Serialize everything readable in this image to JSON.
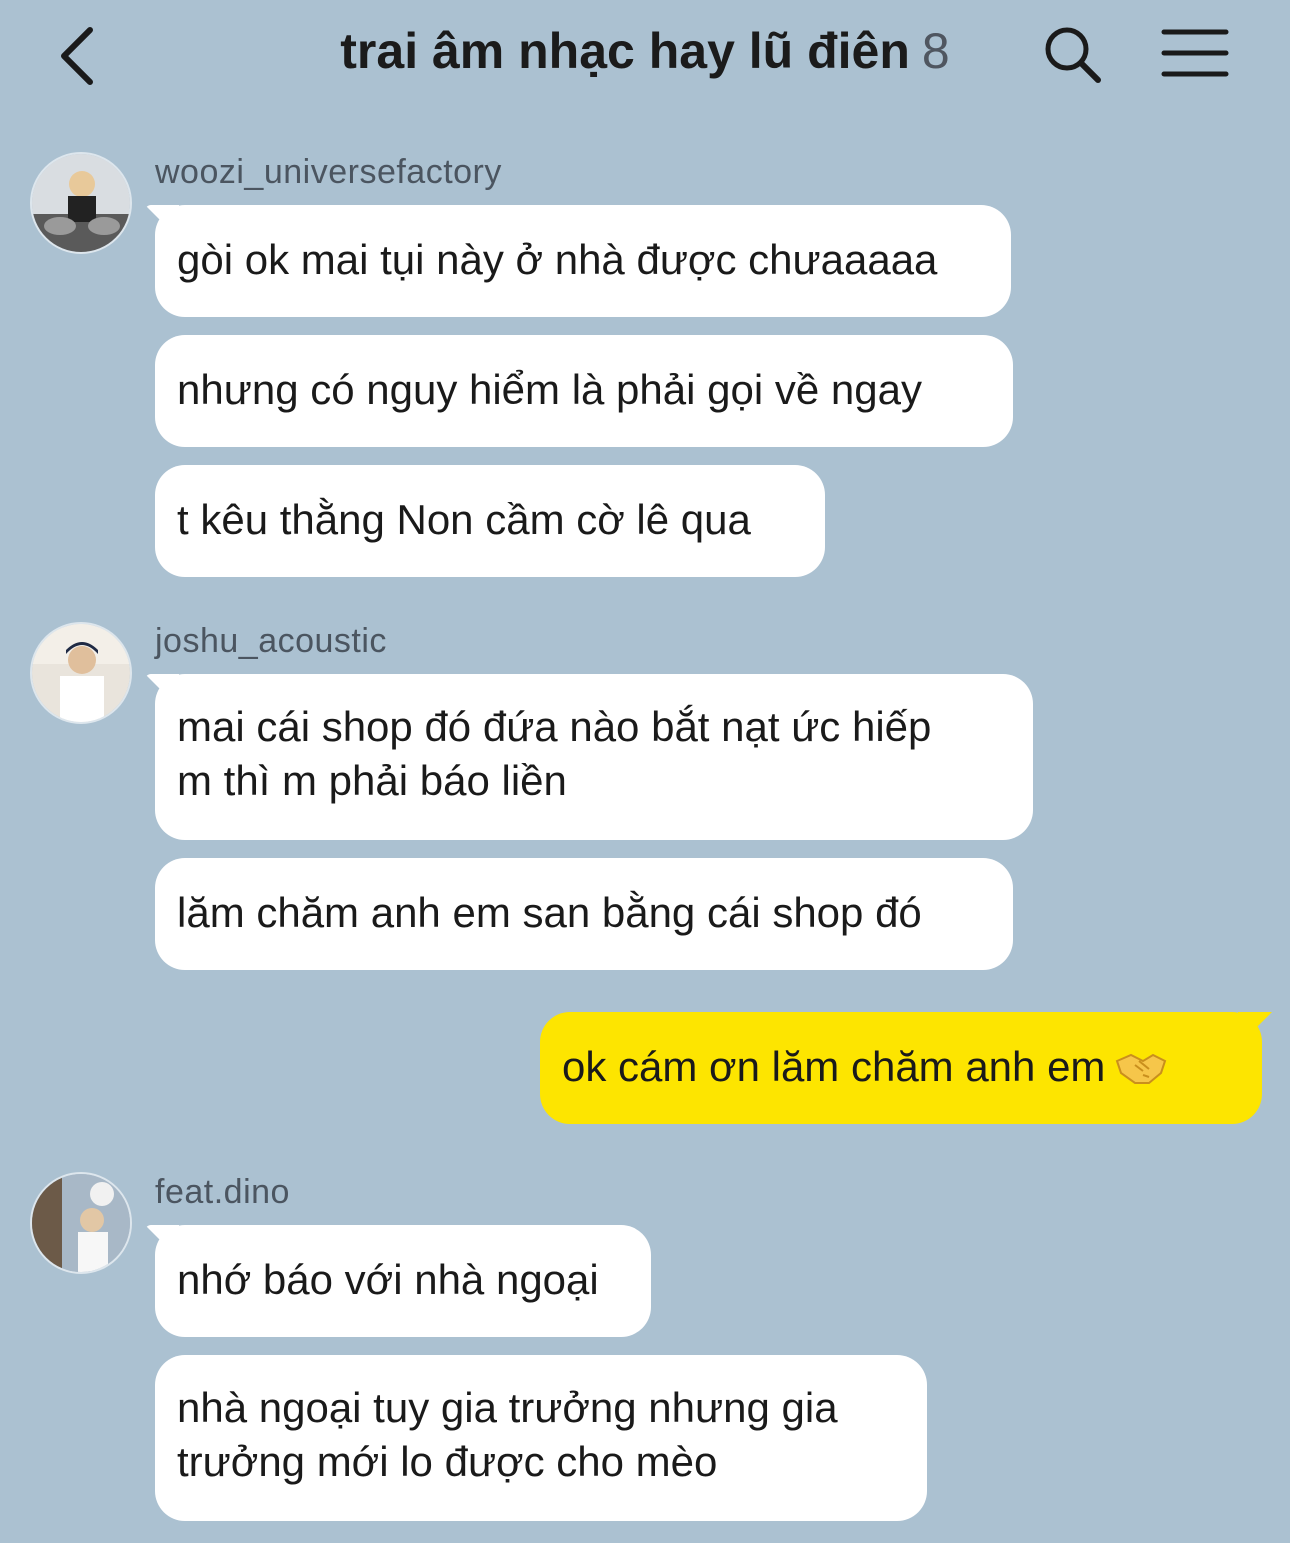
{
  "header": {
    "title": "trai âm nhạc hay lũ điên",
    "member_count": "8",
    "icons": {
      "back": "chevron-left-icon",
      "search": "search-icon",
      "menu": "hamburger-menu-icon"
    }
  },
  "colors": {
    "background": "#abc1d1",
    "incoming_bubble": "#ffffff",
    "outgoing_bubble": "#fde500"
  },
  "messages": [
    {
      "sender": "woozi_universefactory",
      "bubbles": [
        "gòi ok mai tụi này ở nhà được chưaaaaa",
        "nhưng có nguy hiểm là phải gọi về ngay",
        "t kêu thằng Non cầm cờ lê qua"
      ]
    },
    {
      "sender": "joshu_acoustic",
      "bubbles": [
        "mai cái shop đó đứa nào bắt nạt ức hiếp\nm thì m phải báo liền",
        "lăm chăm anh em san bằng cái shop đó"
      ]
    },
    {
      "sender": "me",
      "bubbles": [
        "ok cám ơn lăm chăm anh em"
      ],
      "emoji": "handshake-emoji"
    },
    {
      "sender": "feat.dino",
      "bubbles": [
        "nhớ báo với nhà ngoại",
        "nhà ngoại tuy gia trưởng nhưng gia\ntrưởng mới lo được cho mèo"
      ]
    }
  ]
}
